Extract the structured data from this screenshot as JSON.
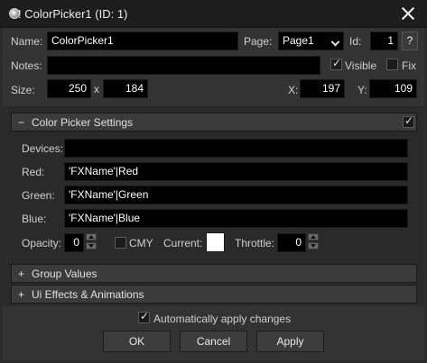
{
  "window": {
    "title": "ColorPicker1 (ID: 1)",
    "title_prefix": "!",
    "icon": "widget-icon",
    "close_icon": "close-icon"
  },
  "header": {
    "name_label": "Name:",
    "name_value": "ColorPicker1",
    "page_label": "Page:",
    "page_value": "Page1",
    "id_label": "Id:",
    "id_value": "1",
    "help_label": "?",
    "notes_label": "Notes:",
    "notes_value": "",
    "visible_label": "Visible",
    "visible_checked": true,
    "fix_label": "Fix",
    "fix_checked": false,
    "size_label": "Size:",
    "width_value": "250",
    "size_sep": "x",
    "height_value": "184",
    "x_label": "X:",
    "x_value": "197",
    "y_label": "Y:",
    "y_value": "109"
  },
  "color_picker_settings": {
    "sign": "−",
    "title": "Color Picker Settings",
    "enabled": true,
    "devices_label": "Devices:",
    "devices_value": "",
    "red_label": "Red:",
    "red_value": "'FXName'|Red",
    "green_label": "Green:",
    "green_value": "'FXName'|Green",
    "blue_label": "Blue:",
    "blue_value": "'FXName'|Blue",
    "opacity_label": "Opacity:",
    "opacity_value": "0",
    "cmy_label": "CMY",
    "cmy_checked": false,
    "current_label": "Current:",
    "current_color": "#ffffff",
    "throttle_label": "Throttle:",
    "throttle_value": "0"
  },
  "group_values": {
    "sign": "+",
    "title": "Group Values"
  },
  "ui_effects": {
    "sign": "+",
    "title": "Ui Effects & Animations"
  },
  "footer": {
    "auto_apply_label": "Automatically apply changes",
    "auto_apply_checked": true,
    "ok_label": "OK",
    "cancel_label": "Cancel",
    "apply_label": "Apply"
  }
}
